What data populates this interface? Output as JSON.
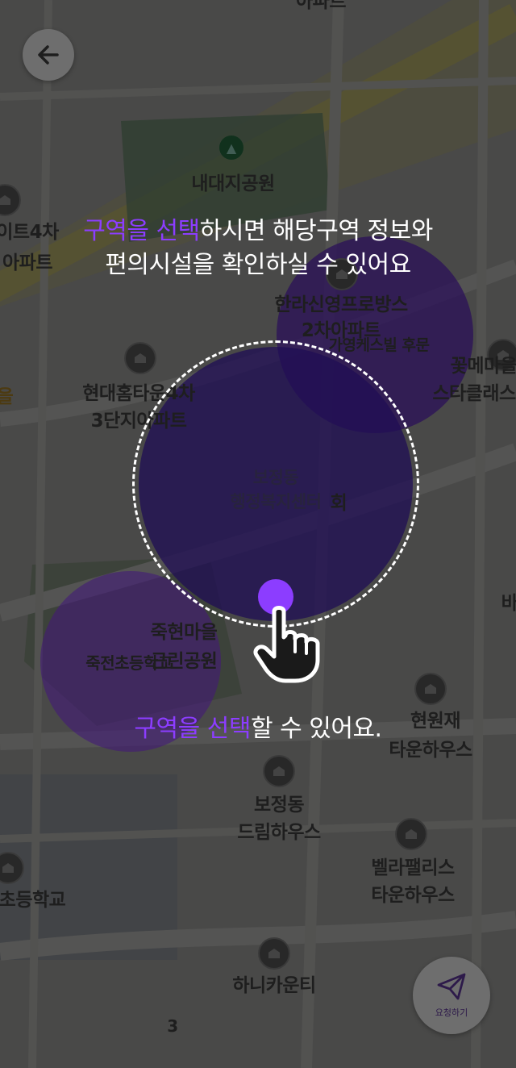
{
  "header": {
    "back_icon": "arrow-left-icon"
  },
  "map_labels": {
    "top_apt": "아파트",
    "park": "내대지공원",
    "left_apt_1": "이트4차",
    "left_apt_2": "아파트",
    "halla_1": "한라신영프로방스",
    "halla_2": "2차아파트",
    "back_gate": "가영케스빌 후문",
    "hyundai_1": "현대홈타운4차",
    "hyundai_2": "3단지아파트",
    "flower_1": "꽃메마을",
    "flower_2": "스타클래스",
    "left_edge": "을",
    "center_1": "보정동",
    "center_2": "행정복지센터",
    "center_suffix": "회",
    "jukhyeon_1": "죽현마을",
    "jukhyeon_2": "근린공원",
    "jukjeon": "죽전초등학교",
    "hyeonwon_1": "현원재",
    "hyeonwon_2": "타운하우스",
    "right_edge": "바",
    "bojeong_1": "보정동",
    "bojeong_2": "드림하우스",
    "villa_1": "벨라팰리스",
    "villa_2": "타운하우스",
    "school": "초등학교",
    "honey": "하니카운티",
    "num": "3"
  },
  "overlay": {
    "headline_accent": "구역을 선택",
    "headline_rest": "하시면 해당구역 정보와",
    "headline_line2": "편의시설을 확인하실 수 있어요",
    "sub_accent": "구역을 선택",
    "sub_rest": "할 수 있어요."
  },
  "request_button": {
    "label": "요청하기",
    "icon": "paper-plane-icon"
  },
  "colors": {
    "accent": "#8c3dff",
    "zone": "#3a1a9a",
    "zone_purple": "#7a2fd8"
  }
}
